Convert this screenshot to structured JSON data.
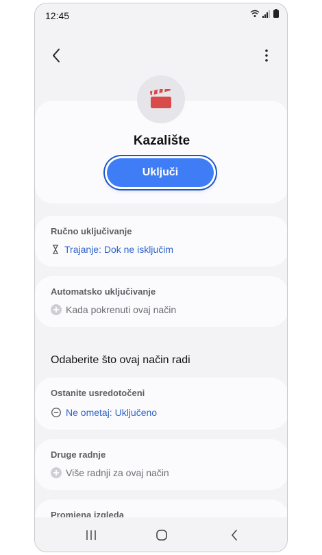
{
  "status": {
    "time": "12:45"
  },
  "mode": {
    "title": "Kazalište",
    "turn_on_label": "Uključi"
  },
  "manual": {
    "title": "Ručno uključivanje",
    "duration": "Trajanje: Dok ne isključim"
  },
  "auto": {
    "title": "Automatsko uključivanje",
    "when": "Kada pokrenuti ovaj način"
  },
  "choose_heading": "Odaberite što ovaj način radi",
  "focus": {
    "title": "Ostanite usredotočeni",
    "dnd": "Ne ometaj: Uključeno"
  },
  "other": {
    "title": "Druge radnje",
    "more": "Više radnji za ovaj način"
  },
  "appearance": {
    "title": "Promjena izgleda"
  },
  "colors": {
    "accent": "#3e7df5",
    "link": "#2f63c9",
    "icon_red": "#d94b4b"
  }
}
